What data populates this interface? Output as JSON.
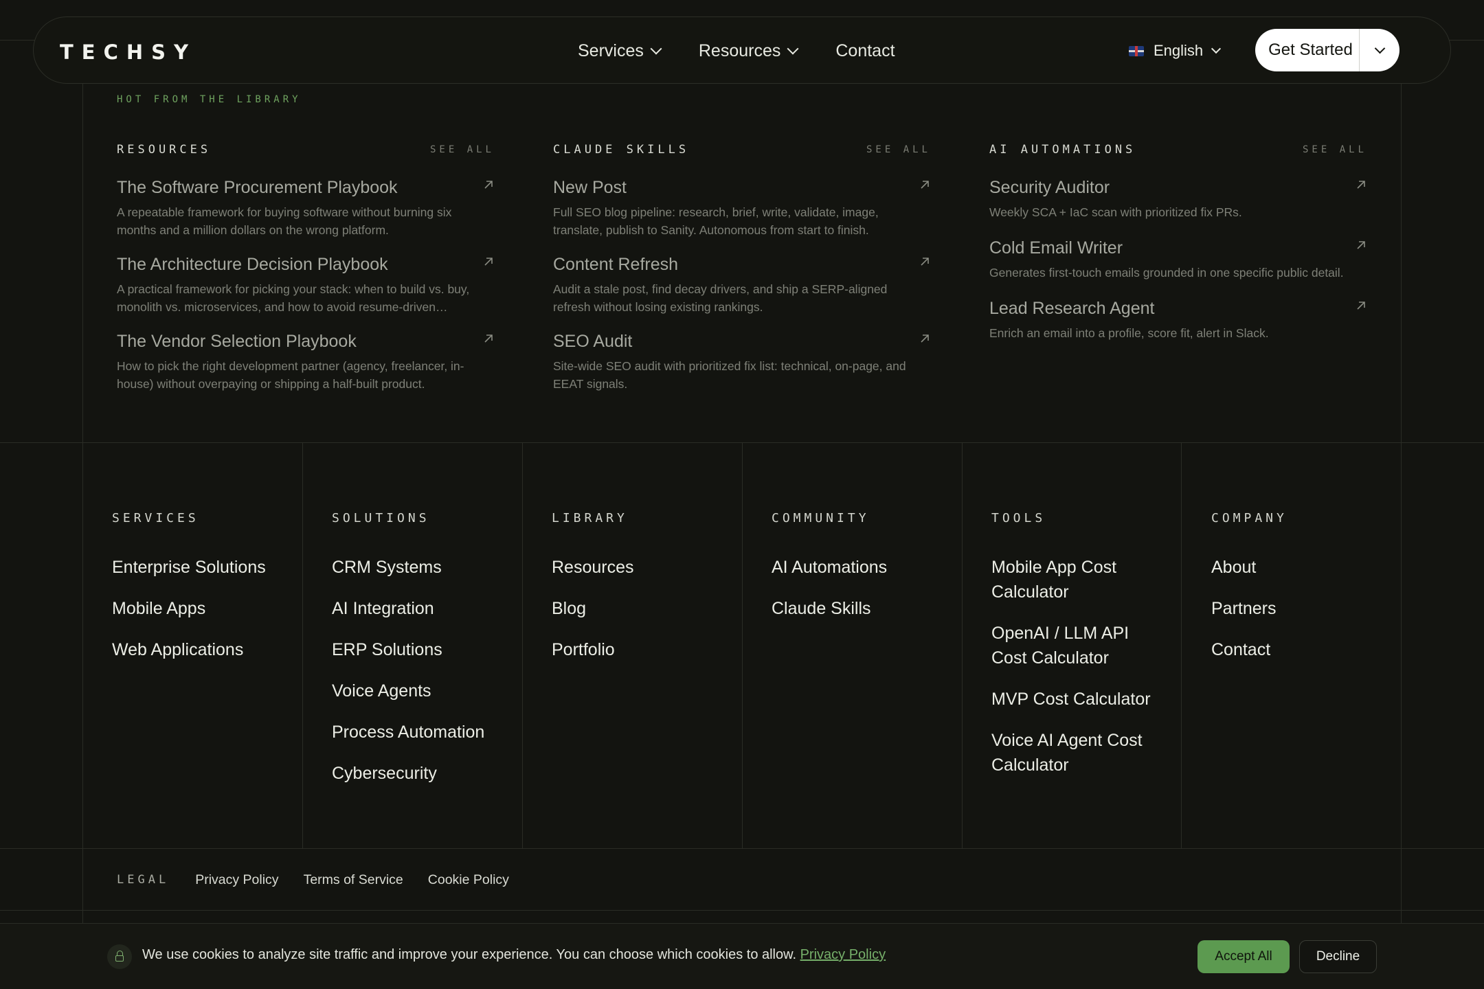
{
  "header": {
    "logo": "TECHSY",
    "nav": [
      {
        "label": "Services"
      },
      {
        "label": "Resources"
      },
      {
        "label": "Contact"
      }
    ],
    "language": "English",
    "cta_label": "Get Started"
  },
  "library": {
    "eyebrow": "HOT FROM THE LIBRARY",
    "see_all": "SEE ALL",
    "columns": [
      {
        "title": "RESOURCES",
        "items": [
          {
            "title": "The Software Procurement Playbook",
            "desc": "A repeatable framework for buying software without burning six months and a million dollars on the wrong platform."
          },
          {
            "title": "The Architecture Decision Playbook",
            "desc": "A practical framework for picking your stack: when to build vs. buy, monolith vs. microservices, and how to avoid resume-driven…"
          },
          {
            "title": "The Vendor Selection Playbook",
            "desc": "How to pick the right development partner (agency, freelancer, in-house) without overpaying or shipping a half-built product."
          }
        ]
      },
      {
        "title": "CLAUDE SKILLS",
        "items": [
          {
            "title": "New Post",
            "desc": "Full SEO blog pipeline: research, brief, write, validate, image, translate, publish to Sanity. Autonomous from start to finish."
          },
          {
            "title": "Content Refresh",
            "desc": "Audit a stale post, find decay drivers, and ship a SERP-aligned refresh without losing existing rankings."
          },
          {
            "title": "SEO Audit",
            "desc": "Site-wide SEO audit with prioritized fix list: technical, on-page, and EEAT signals."
          }
        ]
      },
      {
        "title": "AI AUTOMATIONS",
        "items": [
          {
            "title": "Security Auditor",
            "desc": "Weekly SCA + IaC scan with prioritized fix PRs."
          },
          {
            "title": "Cold Email Writer",
            "desc": "Generates first-touch emails grounded in one specific public detail."
          },
          {
            "title": "Lead Research Agent",
            "desc": "Enrich an email into a profile, score fit, alert in Slack."
          }
        ]
      }
    ]
  },
  "footer": {
    "columns": [
      {
        "title": "SERVICES",
        "links": [
          "Enterprise Solutions",
          "Mobile Apps",
          "Web Applications"
        ]
      },
      {
        "title": "SOLUTIONS",
        "links": [
          "CRM Systems",
          "AI Integration",
          "ERP Solutions",
          "Voice Agents",
          "Process Automation",
          "Cybersecurity"
        ]
      },
      {
        "title": "LIBRARY",
        "links": [
          "Resources",
          "Blog",
          "Portfolio"
        ]
      },
      {
        "title": "COMMUNITY",
        "links": [
          "AI Automations",
          "Claude Skills"
        ]
      },
      {
        "title": "TOOLS",
        "links": [
          "Mobile App Cost Calculator",
          "OpenAI / LLM API Cost Calculator",
          "MVP Cost Calculator",
          "Voice AI Agent Cost Calculator"
        ]
      },
      {
        "title": "COMPANY",
        "links": [
          "About",
          "Partners",
          "Contact"
        ]
      }
    ],
    "legal": {
      "title": "LEGAL",
      "links": [
        "Privacy Policy",
        "Terms of Service",
        "Cookie Policy"
      ]
    }
  },
  "cookie": {
    "text": "We use cookies to analyze site traffic and improve your experience. You can choose which cookies to allow.",
    "link": "Privacy Policy",
    "accept": "Accept All",
    "decline": "Decline"
  },
  "colors": {
    "background": "#131410",
    "accent_green": "#5c9a50",
    "eyebrow_green": "#6fa35f"
  },
  "icons": [
    "chevron-down-icon",
    "uk-flag-icon",
    "arrow-up-right-icon",
    "lock-icon"
  ]
}
